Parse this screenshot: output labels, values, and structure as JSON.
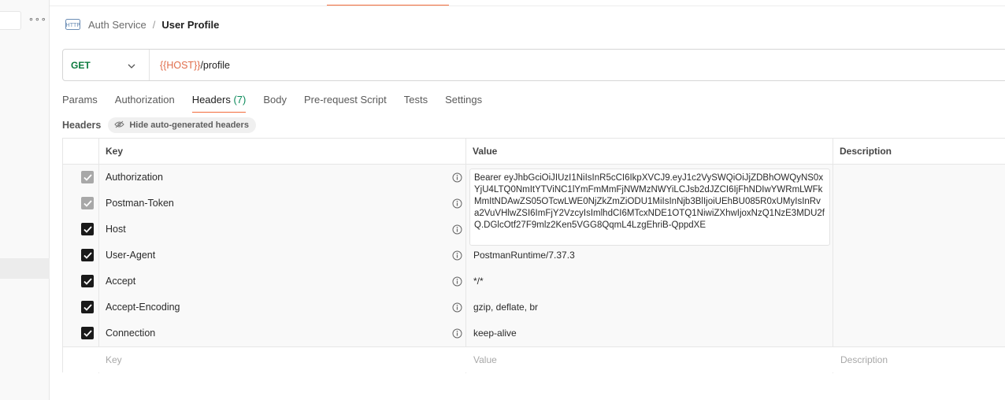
{
  "breadcrumb": {
    "parent": "Auth Service",
    "separator": "/",
    "current": "User Profile"
  },
  "request": {
    "method": "GET",
    "url_variable": "{{HOST}}",
    "url_path": "/profile"
  },
  "tabs": [
    {
      "label": "Params"
    },
    {
      "label": "Authorization"
    },
    {
      "label": "Headers",
      "count": "(7)",
      "active": true
    },
    {
      "label": "Body"
    },
    {
      "label": "Pre-request Script"
    },
    {
      "label": "Tests"
    },
    {
      "label": "Settings"
    }
  ],
  "headers_section": {
    "title": "Headers",
    "hide_button": "Hide auto-generated headers"
  },
  "table": {
    "columns": {
      "key": "Key",
      "value": "Value",
      "description": "Description"
    },
    "rows": [
      {
        "key": "Authorization",
        "checked": "disabled",
        "value": "Bearer eyJhbGciOiJIUzI1NiIsInR5cCI6IkpXVCJ9.eyJ1c2VySWQiOiJjZDBhOWQyNS0xYjU4LTQ0NmItYTViNC1lYmFmMmFjNWMzNWYiLCJsb2dJZCI6IjFhNDIwYWRmLWFkMmItNDAwZS05OTcwLWE0NjZkZmZiODU1MiIsInNjb3BlIjoiUEhBU085R0xUMyIsInRva2VuVHlwZSI6ImFjY2VzcyIsImlhdCI6MTcxNDE1OTQ1NiwiZXhwIjoxNzQ1NzE3MDU2fQ.DGlcOtf27F9mlz2Ken5VGG8QqmL4LzgEhriB-QppdXE"
      },
      {
        "key": "Postman-Token",
        "checked": "disabled",
        "value": ""
      },
      {
        "key": "Host",
        "checked": "on",
        "value": ""
      },
      {
        "key": "User-Agent",
        "checked": "on",
        "value": "PostmanRuntime/7.37.3"
      },
      {
        "key": "Accept",
        "checked": "on",
        "value": "*/*"
      },
      {
        "key": "Accept-Encoding",
        "checked": "on",
        "value": "gzip, deflate, br"
      },
      {
        "key": "Connection",
        "checked": "on",
        "value": "keep-alive"
      }
    ],
    "new_row": {
      "key_placeholder": "Key",
      "value_placeholder": "Value",
      "description_placeholder": "Description"
    }
  },
  "colors": {
    "accent": "#f26b3a",
    "method_get": "#0b7a3e",
    "url_variable": "#e06c4a",
    "count": "#0b8a5a"
  }
}
